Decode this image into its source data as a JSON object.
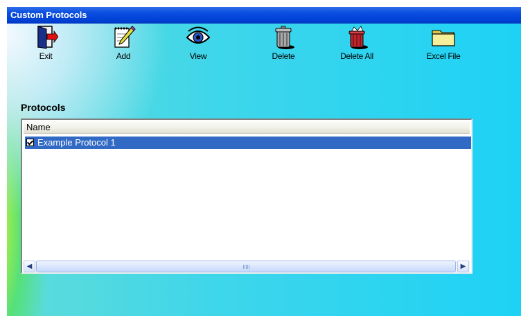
{
  "window": {
    "title": "Custom Protocols"
  },
  "toolbar": {
    "items": [
      {
        "label": "Exit",
        "icon": "exit-door-icon"
      },
      {
        "label": "Add",
        "icon": "notepad-pencil-icon"
      },
      {
        "label": "View",
        "icon": "eye-icon"
      },
      {
        "label": "Delete",
        "icon": "trash-can-icon"
      },
      {
        "label": "Delete All",
        "icon": "trash-full-icon"
      },
      {
        "label": "Excel File",
        "icon": "folder-icon"
      }
    ]
  },
  "protocols": {
    "section_label": "Protocols",
    "column_name": "Name",
    "rows": [
      {
        "name": "Example Protocol 1",
        "checked": true,
        "selected": true
      }
    ]
  },
  "colors": {
    "titlebar": "#0041d6",
    "selection": "#316ac5",
    "background": "#1ed2f5"
  }
}
